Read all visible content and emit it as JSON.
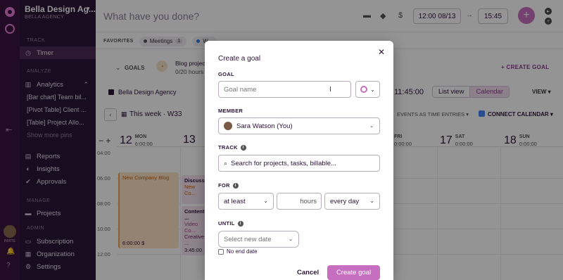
{
  "workspace": {
    "name": "Bella Design Ag...",
    "subtitle": "BELLA AGENCY"
  },
  "rail": {
    "user_label": "INVITE"
  },
  "sidebar": {
    "track_heading": "TRACK",
    "timer": "Timer",
    "analyze_heading": "ANALYZE",
    "analytics": "Analytics",
    "pins": [
      "[Bar chart] Team bil...",
      "[Pivot Table] Client ...",
      "[Table] Project Allo..."
    ],
    "show_more": "Show more pins",
    "reports": "Reports",
    "insights": "Insights",
    "approvals": "Approvals",
    "manage_heading": "MANAGE",
    "projects": "Projects",
    "admin_heading": "ADMIN",
    "subscription": "Subscription",
    "organization": "Organization",
    "settings": "Settings"
  },
  "topbar": {
    "placeholder": "What have you done?",
    "start_time": "12:00 08/13",
    "arrow": "→",
    "end_time": "15:45"
  },
  "favorites": {
    "label": "FAVORITES",
    "chips": [
      {
        "label": "Meetings",
        "count": "1"
      },
      {
        "label": "W..."
      }
    ]
  },
  "goals_row": {
    "label": "GOALS",
    "goal_title": "Blog project",
    "goal_progress": "0/20 hours",
    "create_label": "CREATE GOAL"
  },
  "calendar_header": {
    "workspace": "Bella Design Agency",
    "time": "11:45:00",
    "list_view": "List view",
    "calendar": "Calendar",
    "view": "VIEW",
    "week_label": "This week · W33",
    "events_label": "EVENTS AS TIME ENTRIES",
    "connect_calendar": "CONNECT CALENDAR"
  },
  "days": [
    {
      "num": "12",
      "name": "MON",
      "total": "6:00:00"
    },
    {
      "num": "13",
      "name": "",
      "total": ""
    },
    {
      "num": "",
      "name": "FRI",
      "total": "0:00:00"
    },
    {
      "num": "17",
      "name": "SAT",
      "total": "0:00:00"
    },
    {
      "num": "18",
      "name": "SUN",
      "total": "0:00:00"
    }
  ],
  "hours": [
    "04:00",
    "06:00",
    "08:00",
    "10:00",
    "12:00"
  ],
  "events": [
    {
      "title": "New Company Blog",
      "foot": "6:00:00 $"
    },
    {
      "title": "Discussi...",
      "subtitle": "New Co..."
    },
    {
      "title": "Content ...",
      "subtitle": "Video Co...",
      "extra": "Creative ...",
      "foot": "3:45:00"
    }
  ],
  "modal": {
    "title": "Create a goal",
    "goal_label": "GOAL",
    "goal_placeholder": "Goal name",
    "member_label": "MEMBER",
    "member_value": "Sara Watson (You)",
    "track_label": "TRACK",
    "track_placeholder": "Search for projects, tasks, billable...",
    "for_label": "FOR",
    "for_mode": "at least",
    "hours_placeholder": "hours",
    "frequency": "every day",
    "until_label": "UNTIL",
    "until_placeholder": "Select new date",
    "no_end_date": "No end date",
    "cancel": "Cancel",
    "create": "Create goal"
  }
}
